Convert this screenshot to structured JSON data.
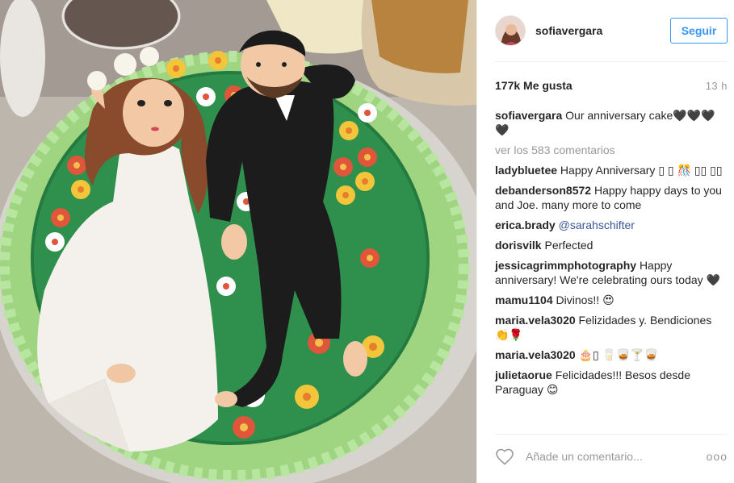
{
  "post": {
    "photo_alt": "Anniversary cake photo",
    "header": {
      "username": "sofiavergara",
      "follow_label": "Seguir"
    },
    "likes": "177k Me gusta",
    "time": "13 h",
    "caption": {
      "user": "sofiavergara",
      "text": "Our anniversary cake🖤🖤🖤🖤"
    },
    "view_all": "ver los 583 comentarios",
    "comments": [
      {
        "user": "ladybluetee",
        "text": "Happy Anniversary ▯ ▯ 🎊 ▯▯ ▯▯"
      },
      {
        "user": "debanderson8572",
        "text": "Happy happy days to you and Joe. many more to come"
      },
      {
        "user": "erica.brady",
        "text": "@sarahschifter"
      },
      {
        "user": "dorisvilk",
        "text": "Perfected"
      },
      {
        "user": "jessicagrimmphotography",
        "text": "Happy anniversary! We're celebrating ours today 🖤"
      },
      {
        "user": "mamu1104",
        "text": "Divinos!! 😍"
      },
      {
        "user": "maria.vela3020",
        "text": "Felizidades y. Bendiciones 👏🌹"
      },
      {
        "user": "maria.vela3020",
        "text": "🎂▯ 🥛🥃🍸🥃"
      },
      {
        "user": "julietaorue",
        "text": "Felicidades!!! Besos desde Paraguay 😊"
      }
    ],
    "add_comment_placeholder": "Añade un comentario...",
    "more_label": "ooo"
  },
  "icons": {
    "like": "heart-outline-icon",
    "options": "more-options-icon"
  },
  "colors": {
    "accent": "#3897f0",
    "muted": "#999999",
    "mention": "#365899"
  }
}
